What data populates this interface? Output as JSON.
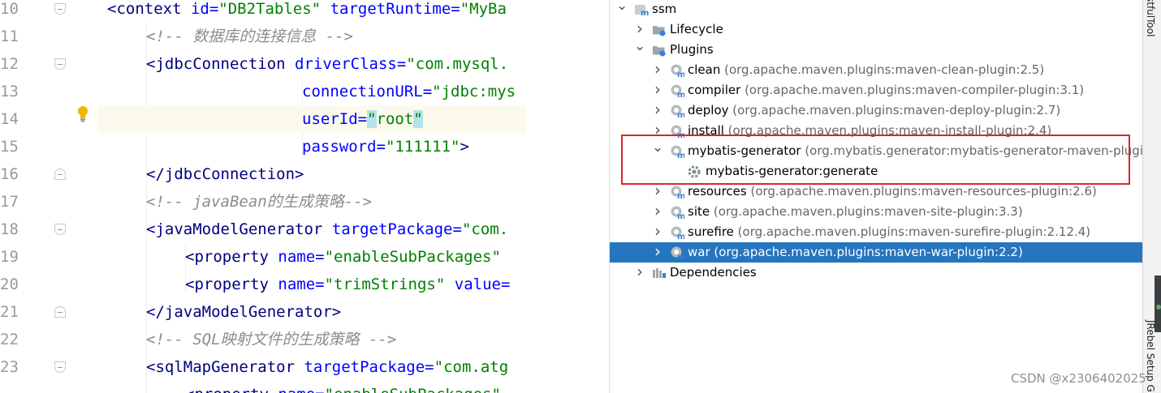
{
  "editor": {
    "line_numbers": [
      "10",
      "11",
      "12",
      "13",
      "14",
      "15",
      "16",
      "17",
      "18",
      "19",
      "20",
      "21",
      "22",
      "23"
    ],
    "lines": [
      [
        {
          "t": "tg",
          "v": "<context "
        },
        {
          "t": "at",
          "v": "id="
        },
        {
          "t": "vl",
          "v": "\"DB2Tables\" "
        },
        {
          "t": "at",
          "v": "targetRuntime="
        },
        {
          "t": "vl",
          "v": "\"MyBa"
        }
      ],
      [
        {
          "t": "cm",
          "v": "<!-- 数据库的连接信息 -->"
        }
      ],
      [
        {
          "t": "tg",
          "v": "<jdbcConnection "
        },
        {
          "t": "at",
          "v": "driverClass="
        },
        {
          "t": "vl",
          "v": "\"com.mysql."
        }
      ],
      [
        {
          "t": "at",
          "v": "connectionURL="
        },
        {
          "t": "vl",
          "v": "\"jdbc:mys"
        }
      ],
      [
        {
          "t": "at",
          "v": "userId="
        },
        {
          "t": "vlsel",
          "v": "\""
        },
        {
          "t": "vl",
          "v": "root"
        },
        {
          "t": "vlsel",
          "v": "\""
        }
      ],
      [
        {
          "t": "at",
          "v": "password="
        },
        {
          "t": "vl",
          "v": "\"111111\""
        },
        {
          "t": "tg",
          "v": ">"
        }
      ],
      [
        {
          "t": "tg",
          "v": "</jdbcConnection>"
        }
      ],
      [
        {
          "t": "cm",
          "v": "<!-- javaBean的生成策略-->"
        }
      ],
      [
        {
          "t": "tg",
          "v": "<javaModelGenerator "
        },
        {
          "t": "at",
          "v": "targetPackage="
        },
        {
          "t": "vl",
          "v": "\"com."
        }
      ],
      [
        {
          "t": "tg",
          "v": "<property "
        },
        {
          "t": "at",
          "v": "name="
        },
        {
          "t": "vl",
          "v": "\"enableSubPackages\""
        }
      ],
      [
        {
          "t": "tg",
          "v": "<property "
        },
        {
          "t": "at",
          "v": "name="
        },
        {
          "t": "vl",
          "v": "\"trimStrings\" "
        },
        {
          "t": "at",
          "v": "value="
        }
      ],
      [
        {
          "t": "tg",
          "v": "</javaModelGenerator>"
        }
      ],
      [
        {
          "t": "cm",
          "v": "<!-- SQL映射文件的生成策略 -->"
        }
      ],
      [
        {
          "t": "tg",
          "v": "<sqlMapGenerator "
        },
        {
          "t": "at",
          "v": "targetPackage="
        },
        {
          "t": "vl",
          "v": "\"com.atg"
        }
      ],
      [
        {
          "t": "tg",
          "v": "<property "
        },
        {
          "t": "at",
          "v": "name="
        },
        {
          "t": "vl",
          "v": "\"enableSubPackages\""
        }
      ]
    ]
  },
  "maven": {
    "rows": [
      {
        "label": "ssm",
        "coords": "",
        "arrow": "down",
        "icon": "maven-project-icon"
      },
      {
        "label": "Lifecycle",
        "coords": "",
        "arrow": "right",
        "icon": "lifecycle-folder-icon"
      },
      {
        "label": "Plugins",
        "coords": "",
        "arrow": "down",
        "icon": "plugins-folder-icon"
      },
      {
        "label": "clean",
        "coords": " (org.apache.maven.plugins:maven-clean-plugin:2.5)",
        "arrow": "right",
        "icon": "maven-plugin-icon"
      },
      {
        "label": "compiler",
        "coords": " (org.apache.maven.plugins:maven-compiler-plugin:3.1)",
        "arrow": "right",
        "icon": "maven-plugin-icon"
      },
      {
        "label": "deploy",
        "coords": " (org.apache.maven.plugins:maven-deploy-plugin:2.7)",
        "arrow": "right",
        "icon": "maven-plugin-icon"
      },
      {
        "label": "install",
        "coords": " (org.apache.maven.plugins:maven-install-plugin:2.4)",
        "arrow": "right",
        "icon": "maven-plugin-icon"
      },
      {
        "label": "mybatis-generator",
        "coords": " (org.mybatis.generator:mybatis-generator-maven-plugin:",
        "arrow": "down",
        "icon": "maven-plugin-icon"
      },
      {
        "label": "mybatis-generator:generate",
        "coords": "",
        "arrow": "",
        "icon": "gear-icon"
      },
      {
        "label": "resources",
        "coords": " (org.apache.maven.plugins:maven-resources-plugin:2.6)",
        "arrow": "right",
        "icon": "maven-plugin-icon"
      },
      {
        "label": "site",
        "coords": " (org.apache.maven.plugins:maven-site-plugin:3.3)",
        "arrow": "right",
        "icon": "maven-plugin-icon"
      },
      {
        "label": "surefire",
        "coords": " (org.apache.maven.plugins:maven-surefire-plugin:2.12.4)",
        "arrow": "right",
        "icon": "maven-plugin-icon"
      },
      {
        "label": "war",
        "coords": " (org.apache.maven.plugins:maven-war-plugin:2.2)",
        "arrow": "right",
        "icon": "maven-plugin-icon",
        "selected": true
      },
      {
        "label": "Dependencies",
        "coords": "",
        "arrow": "right",
        "icon": "dependencies-folder-icon"
      }
    ]
  },
  "strip": {
    "top_label": "stfulTool",
    "bottom_label": "JRebel Setup G"
  },
  "watermark": "CSDN @x2306402025",
  "colors": {
    "selection": "#2675bf",
    "highlight_box": "#d9262c",
    "tag": "#000080",
    "attr": "#0000ff",
    "value": "#008000",
    "comment": "#8c8c8c"
  }
}
